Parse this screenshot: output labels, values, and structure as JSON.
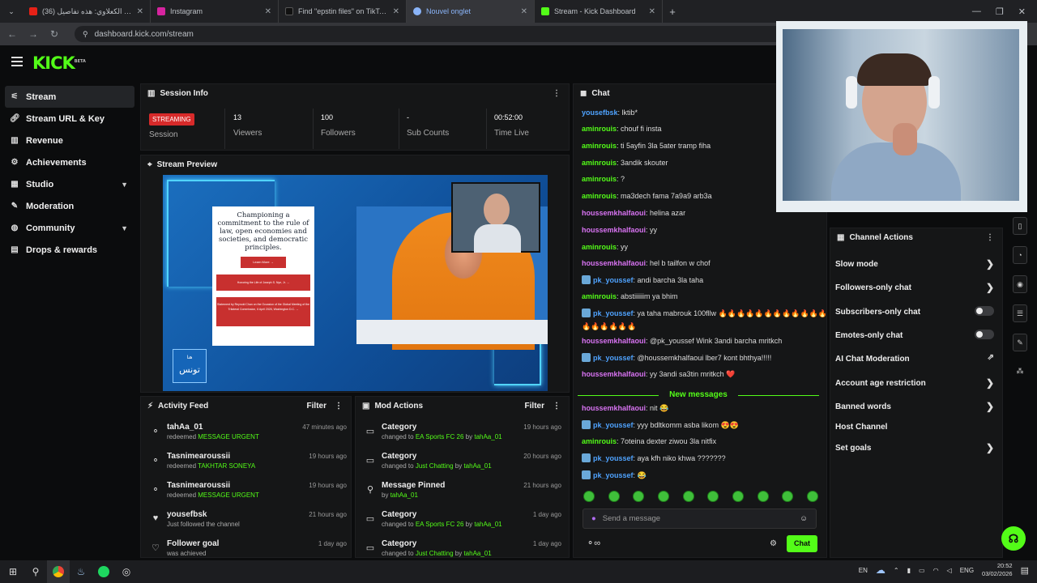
{
  "browser": {
    "tabs": [
      {
        "title": "(36) طارق الكعلاوي: هذه تفاصيل",
        "color": "#e62117"
      },
      {
        "title": "Instagram",
        "color": "#d6249f"
      },
      {
        "title": "Find \"epstin files\" on TikTok | TikTok",
        "color": "#111111"
      },
      {
        "title": "Nouvel onglet",
        "color": "#8ab4f8"
      },
      {
        "title": "Stream - Kick Dashboard",
        "color": "#53fc18"
      }
    ],
    "url": "dashboard.kick.com/stream",
    "new_tab": "+"
  },
  "brand": {
    "logo": "KICK",
    "beta": "BETA"
  },
  "sidebar": {
    "items": [
      {
        "label": "Stream",
        "icon": "sliders-icon"
      },
      {
        "label": "Stream URL & Key",
        "icon": "link-icon"
      },
      {
        "label": "Revenue",
        "icon": "chart-icon"
      },
      {
        "label": "Achievements",
        "icon": "gear-icon"
      },
      {
        "label": "Studio",
        "icon": "studio-icon"
      },
      {
        "label": "Moderation",
        "icon": "wrench-icon"
      },
      {
        "label": "Community",
        "icon": "globe-icon"
      },
      {
        "label": "Drops & rewards",
        "icon": "gift-icon"
      }
    ]
  },
  "session": {
    "title": "Session Info",
    "status": "STREAMING",
    "status_label": "Session",
    "stats": [
      {
        "value": "13",
        "label": "Viewers"
      },
      {
        "value": "100",
        "label": "Followers"
      },
      {
        "value": "-",
        "label": "Sub Counts"
      },
      {
        "value": "00:52:00",
        "label": "Time Live"
      }
    ]
  },
  "preview": {
    "title": "Stream Preview",
    "sheet_heading": "Championing a commitment to the rule of law, open economies and societies, and democratic principles.",
    "sheet_button": "Learn More →",
    "sheet_link1": "Honoring the Life of Joseph S. Nye, Jr. →",
    "sheet_link2": "Statement by Reynold Chan on the Occasion of the Global Meeting of the Trilateral Commission, 6 April 2026, Washington D.C. →",
    "logo_text": "تونس",
    "logo_small": "هنا"
  },
  "activity": {
    "title": "Activity Feed",
    "filter": "Filter",
    "items": [
      {
        "name": "tahAa_01",
        "desc": "redeemed",
        "highlight": "MESSAGE URGENT",
        "time": "47 minutes ago",
        "icon": "reward-icon"
      },
      {
        "name": "Tasnimearoussii",
        "desc": "redeemed",
        "highlight": "TAKHTAR SONEYA",
        "time": "19 hours ago",
        "icon": "reward-icon"
      },
      {
        "name": "Tasnimearoussii",
        "desc": "redeemed",
        "highlight": "MESSAGE URGENT",
        "time": "19 hours ago",
        "icon": "reward-icon"
      },
      {
        "name": "yousefbsk",
        "desc": "Just followed the channel",
        "highlight": "",
        "time": "21 hours ago",
        "icon": "heart-icon"
      },
      {
        "name": "Follower goal",
        "desc": "was achieved",
        "highlight": "",
        "time": "1 day ago",
        "icon": "heart-outline-icon"
      }
    ]
  },
  "mod": {
    "title": "Mod Actions",
    "filter": "Filter",
    "items": [
      {
        "name": "Category",
        "desc": "changed to",
        "target": "EA Sports FC 26",
        "by": "by",
        "user": "tahAa_01",
        "time": "19 hours ago",
        "icon": "category-icon"
      },
      {
        "name": "Category",
        "desc": "changed to",
        "target": "Just Chatting",
        "by": "by",
        "user": "tahAa_01",
        "time": "20 hours ago",
        "icon": "category-icon"
      },
      {
        "name": "Message Pinned",
        "desc": "",
        "target": "",
        "by": "by",
        "user": "tahAa_01",
        "time": "21 hours ago",
        "icon": "pin-icon"
      },
      {
        "name": "Category",
        "desc": "changed to",
        "target": "EA Sports FC 26",
        "by": "by",
        "user": "tahAa_01",
        "time": "1 day ago",
        "icon": "category-icon"
      },
      {
        "name": "Category",
        "desc": "changed to",
        "target": "Just Chatting",
        "by": "by",
        "user": "tahAa_01",
        "time": "1 day ago",
        "icon": "category-icon"
      }
    ]
  },
  "chat": {
    "title": "Chat",
    "messages": [
      {
        "user": "yousefbsk",
        "text": ": lktib*",
        "color": "#4fa3ff",
        "badge": false
      },
      {
        "user": "aminrouis",
        "text": ": chouf fi insta",
        "color": "#53fc18",
        "badge": false
      },
      {
        "user": "aminrouis",
        "text": ": ti 5ayfin 3la 5ater tramp fiha",
        "color": "#53fc18",
        "badge": false
      },
      {
        "user": "aminrouis",
        "text": ": 3andik skouter",
        "color": "#53fc18",
        "badge": false
      },
      {
        "user": "aminrouis",
        "text": ": ?",
        "color": "#53fc18",
        "badge": false
      },
      {
        "user": "aminrouis",
        "text": ": ma3dech fama 7a9a9 arb3a",
        "color": "#53fc18",
        "badge": false
      },
      {
        "user": "houssemkhalfaoui",
        "text": ": helina azar",
        "color": "#d873f2",
        "badge": false
      },
      {
        "user": "houssemkhalfaoui",
        "text": ": yy",
        "color": "#d873f2",
        "badge": false
      },
      {
        "user": "aminrouis",
        "text": ": yy",
        "color": "#53fc18",
        "badge": false
      },
      {
        "user": "houssemkhalfaoui",
        "text": ": hel b tailfon w chof",
        "color": "#d873f2",
        "badge": false
      },
      {
        "user": "pk_youssef",
        "text": ": andi barcha 3la taha",
        "color": "#4fa3ff",
        "badge": true
      },
      {
        "user": "aminrouis",
        "text": ": abstiiiiiim ya bhim",
        "color": "#53fc18",
        "badge": false
      },
      {
        "user": "pk_youssef",
        "text": ": ya taha mabrouk 100fllw 🔥🔥🔥🔥🔥🔥🔥🔥🔥🔥🔥🔥",
        "color": "#4fa3ff",
        "badge": true
      },
      {
        "user": "",
        "text": "🔥🔥🔥🔥🔥🔥",
        "color": "#4fa3ff",
        "badge": false
      },
      {
        "user": "houssemkhalfaoui",
        "text": ": @pk_youssef Wink 3andi barcha mritkch",
        "color": "#d873f2",
        "badge": false
      },
      {
        "user": "pk_youssef",
        "text": ": @houssemkhalfaoui lber7 kont bhthya!!!!!",
        "color": "#4fa3ff",
        "badge": true
      },
      {
        "user": "houssemkhalfaoui",
        "text": ": yy 3andi sa3tin mritkch ❤️",
        "color": "#d873f2",
        "badge": false
      }
    ],
    "new_messages": "New messages",
    "new": [
      {
        "user": "houssemkhalfaoui",
        "text": ": nit 😂",
        "color": "#d873f2",
        "badge": false
      },
      {
        "user": "pk_youssef",
        "text": ": yyy bdltkomm asba likom 😍😍",
        "color": "#4fa3ff",
        "badge": true
      },
      {
        "user": "aminrouis",
        "text": ": 7oteina dexter ziwou 3la nitfix",
        "color": "#53fc18",
        "badge": false
      },
      {
        "user": "pk_youssef",
        "text": ": aya kfh niko khwa ???????",
        "color": "#4fa3ff",
        "badge": true
      },
      {
        "user": "pk_youssef",
        "text": ": 😂",
        "color": "#4fa3ff",
        "badge": true
      }
    ],
    "placeholder": "Send a message",
    "send": "Chat"
  },
  "channel_actions": {
    "title": "Channel Actions",
    "items": [
      {
        "label": "Slow mode",
        "kind": "arrow"
      },
      {
        "label": "Followers-only chat",
        "kind": "arrow"
      },
      {
        "label": "Subscribers-only chat",
        "kind": "toggle"
      },
      {
        "label": "Emotes-only chat",
        "kind": "toggle"
      },
      {
        "label": "AI Chat Moderation",
        "kind": "external"
      },
      {
        "label": "Account age restriction",
        "kind": "arrow"
      },
      {
        "label": "Banned words",
        "kind": "arrow"
      },
      {
        "label": "Host Channel",
        "kind": "none"
      },
      {
        "label": "Set goals",
        "kind": "arrow"
      }
    ]
  },
  "taskbar": {
    "lang": "EN",
    "ime": "ENG",
    "time": "20:52",
    "date": "03/02/2026"
  },
  "colors": {
    "accent": "#53fc18",
    "live": "#d72a2a",
    "panel": "#151617"
  }
}
